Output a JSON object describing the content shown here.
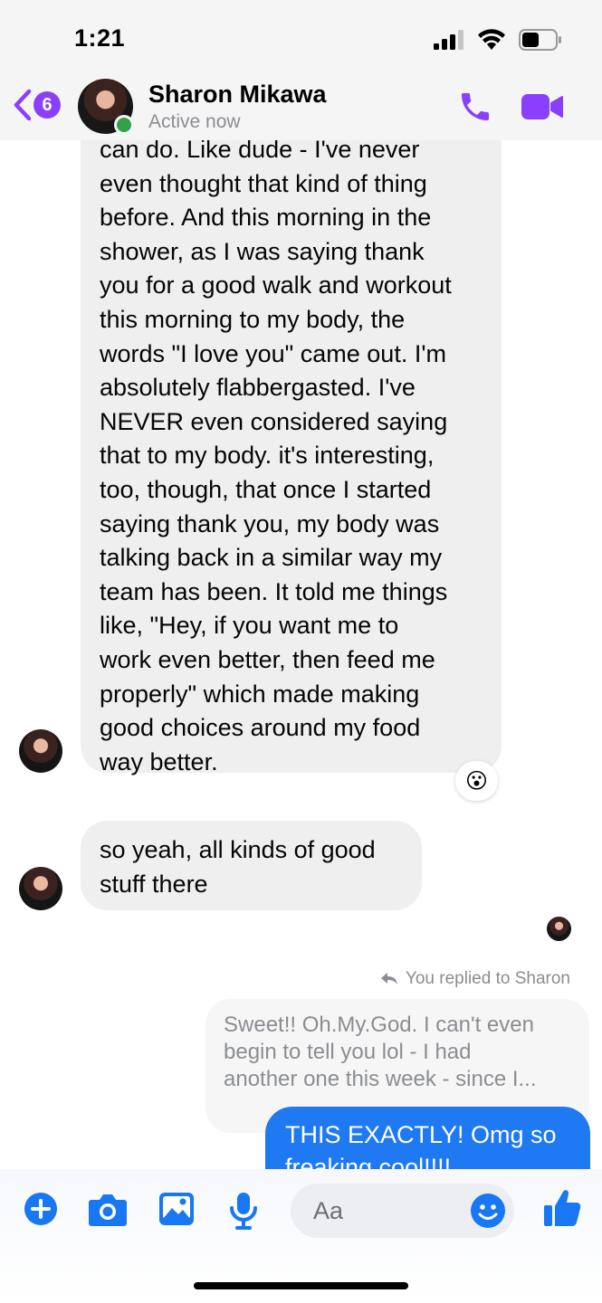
{
  "status_bar": {
    "time": "1:21"
  },
  "header": {
    "back_count": "6",
    "contact_name": "Sharon Mikawa",
    "contact_status": "Active now",
    "accent_color": "#8a3ffc",
    "icons": [
      "chevron-left-icon",
      "phone-icon",
      "video-camera-icon"
    ]
  },
  "messages": {
    "incoming_1": {
      "lines": [
        "can do.  Like dude - I've never",
        "even thought that kind of thing",
        "before. And this morning in the",
        "shower, as I was saying thank",
        "you for a good walk and workout",
        "this morning to my body, the",
        "words \"I love you\" came out. I'm",
        "absolutely flabbergasted. I've",
        "NEVER even considered saying",
        "that to my body. it's interesting,",
        "too, though, that once I started",
        "saying thank you, my body was",
        "talking back in a similar way my",
        "team has been. It told me things",
        "like, \"Hey, if you want me to",
        "work even better, then feed me",
        "properly\" which made making",
        "good choices around my food",
        "way better."
      ],
      "reaction": "😮"
    },
    "incoming_2": {
      "lines": [
        "so yeah, all kinds of good",
        "stuff there"
      ]
    },
    "reply_note": "You replied to Sharon",
    "quoted": {
      "lines": [
        "Sweet!!  Oh.My.God. I can't even",
        "begin to tell you lol - I had",
        "another one this week - since I..."
      ]
    },
    "outgoing_1": {
      "lines": [
        "THIS EXACTLY! Omg so",
        "freaking cool!!!!"
      ]
    }
  },
  "composer": {
    "placeholder": "Aa",
    "icons": [
      "plus-icon",
      "camera-icon",
      "image-icon",
      "microphone-icon",
      "emoji-icon",
      "thumbs-up-icon"
    ],
    "accent_color": "#1877f2"
  }
}
